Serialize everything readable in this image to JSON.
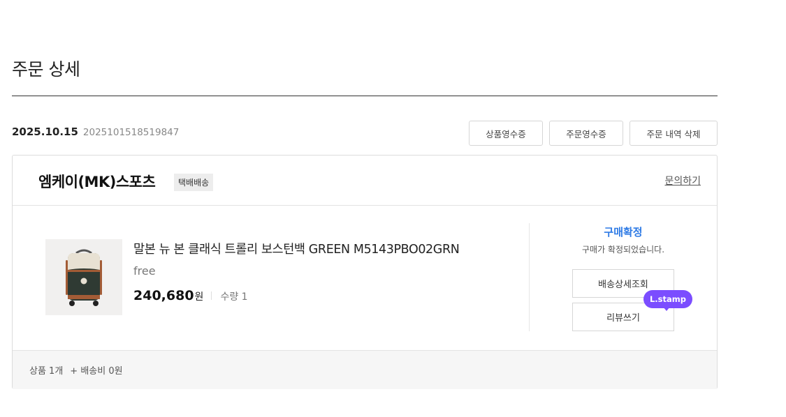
{
  "page": {
    "title": "주문 상세"
  },
  "order": {
    "date": "2025.10.15",
    "number": "2025101518519847",
    "actions": {
      "product_receipt": "상품영수증",
      "order_receipt": "주문영수증",
      "delete_history": "주문 내역 삭제"
    }
  },
  "seller": {
    "name": "엠케이(MK)스포츠",
    "delivery_type": "택배배송",
    "inquiry": "문의하기"
  },
  "product": {
    "name": "말본 뉴 본 클래식 트롤리 보스턴백 GREEN M5143PBO02GRN",
    "option": "free",
    "price": "240,680",
    "price_unit": "원",
    "quantity": "수량 1"
  },
  "status": {
    "title": "구매확정",
    "description": "구매가 확정되었습니다.",
    "tracking_button": "배송상세조회",
    "review_button": "리뷰쓰기",
    "stamp_badge": "L.stamp",
    "accent_color": "#2f7be5",
    "stamp_color": "#7b4dff"
  },
  "summary": {
    "items": "상품 1개",
    "shipping": "+ 배송비 0원"
  }
}
